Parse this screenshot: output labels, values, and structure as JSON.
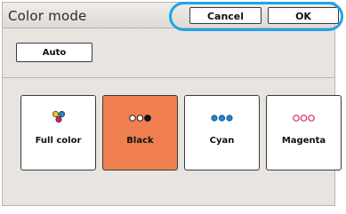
{
  "header": {
    "title": "Color mode",
    "cancel_label": "Cancel",
    "ok_label": "OK"
  },
  "auto_label": "Auto",
  "modes": [
    {
      "label": "Full color",
      "icon": "full-color-dots-icon",
      "selected": false
    },
    {
      "label": "Black",
      "icon": "black-dots-icon",
      "selected": true
    },
    {
      "label": "Cyan",
      "icon": "cyan-dots-icon",
      "selected": false
    },
    {
      "label": "Magenta",
      "icon": "magenta-dots-icon",
      "selected": false
    }
  ],
  "colors": {
    "accent_selected": "#f0804f",
    "highlight": "#1fa3e6",
    "panel": "#e8e5e1",
    "cyan": "#1e88c8",
    "magenta": "#d0246e",
    "yellow": "#f0c419",
    "black": "#111111"
  }
}
